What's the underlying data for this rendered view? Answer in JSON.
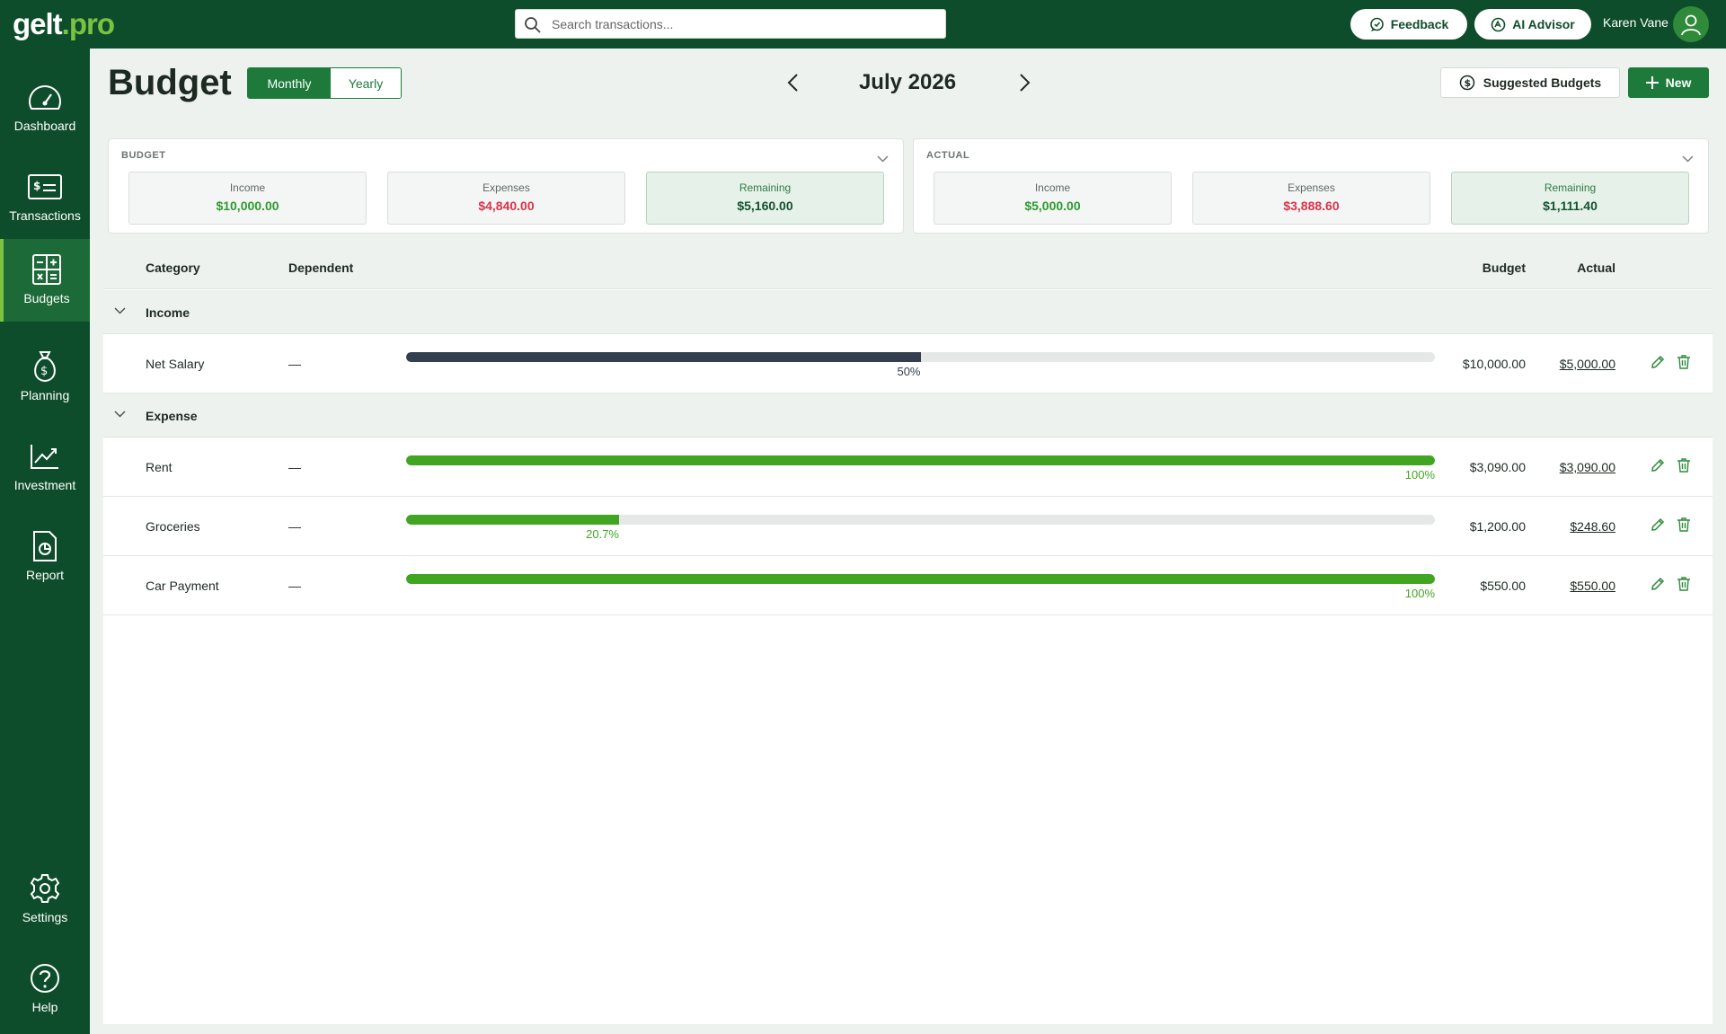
{
  "app": {
    "logo_part1": "gelt",
    "logo_part2": ".pro"
  },
  "search": {
    "placeholder": "Search transactions..."
  },
  "topbar": {
    "feedback_label": "Feedback",
    "ai_label": "AI Advisor",
    "user_name": "Karen Vane"
  },
  "sidebar": {
    "items": [
      {
        "label": "Dashboard",
        "icon": "gauge-icon"
      },
      {
        "label": "Transactions",
        "icon": "bill-icon"
      },
      {
        "label": "Budgets",
        "icon": "calculator-icon",
        "active": true
      },
      {
        "label": "Planning",
        "icon": "money-bag-icon"
      },
      {
        "label": "Investment",
        "icon": "trend-chart-icon"
      },
      {
        "label": "Report",
        "icon": "report-icon"
      }
    ],
    "bottom": [
      {
        "label": "Settings",
        "icon": "gear-icon"
      },
      {
        "label": "Help",
        "icon": "help-icon"
      }
    ]
  },
  "header": {
    "title": "Budget",
    "toggle": {
      "monthly": "Monthly",
      "yearly": "Yearly",
      "selected": "Monthly"
    },
    "period": "July 2026",
    "suggested_label": "Suggested Budgets",
    "new_label": "New"
  },
  "summary": {
    "budget": {
      "title": "BUDGET",
      "income_label": "Income",
      "income": "$10,000.00",
      "expenses_label": "Expenses",
      "expenses": "$4,840.00",
      "remaining_label": "Remaining",
      "remaining": "$5,160.00"
    },
    "actual": {
      "title": "ACTUAL",
      "income_label": "Income",
      "income": "$5,000.00",
      "expenses_label": "Expenses",
      "expenses": "$3,888.60",
      "remaining_label": "Remaining",
      "remaining": "$1,111.40"
    }
  },
  "table": {
    "headers": {
      "category": "Category",
      "dependent": "Dependent",
      "budget": "Budget",
      "actual": "Actual"
    },
    "groups": [
      {
        "label": "Income",
        "rows": [
          {
            "category": "Net Salary",
            "dependent": "—",
            "progress": 0.5,
            "pct_label": "50%",
            "bar_color": "#333f4e",
            "budget": "$10,000.00",
            "actual": "$5,000.00"
          }
        ]
      },
      {
        "label": "Expense",
        "rows": [
          {
            "category": "Rent",
            "dependent": "—",
            "progress": 1.0,
            "pct_label": "100%",
            "bar_color": "#42a522",
            "budget": "$3,090.00",
            "actual": "$3,090.00"
          },
          {
            "category": "Groceries",
            "dependent": "—",
            "progress": 0.207,
            "pct_label": "20.7%",
            "bar_color": "#42a522",
            "budget": "$1,200.00",
            "actual": "$248.60"
          },
          {
            "category": "Car Payment",
            "dependent": "—",
            "progress": 1.0,
            "pct_label": "100%",
            "bar_color": "#42a522",
            "budget": "$550.00",
            "actual": "$550.00"
          }
        ]
      }
    ]
  },
  "colors": {
    "brand": "#0e4d2b",
    "accent": "#7cc242",
    "primary_button": "#1d7a3a",
    "income_green": "#2e9a2e",
    "expense_red": "#d9344a"
  }
}
